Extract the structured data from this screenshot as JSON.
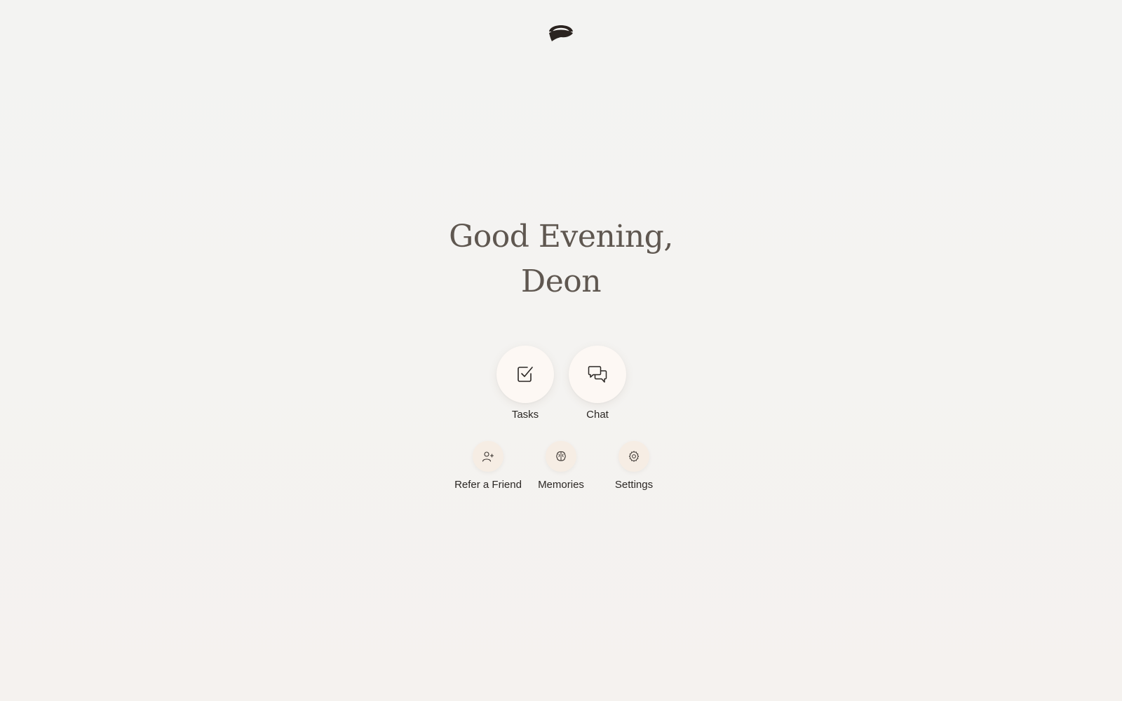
{
  "greeting": {
    "line1": "Good Evening,",
    "line2": "Deon"
  },
  "primary_actions": [
    {
      "label": "Tasks",
      "icon": "checkbox-icon"
    },
    {
      "label": "Chat",
      "icon": "chat-bubbles-icon"
    }
  ],
  "secondary_actions": [
    {
      "label": "Refer a Friend",
      "icon": "user-plus-icon"
    },
    {
      "label": "Memories",
      "icon": "brain-icon"
    },
    {
      "label": "Settings",
      "icon": "gear-icon"
    }
  ],
  "colors": {
    "background": "#f4f3f1",
    "greeting_text": "#5f5750",
    "primary_circle": "#fdf8f4",
    "secondary_circle": "#f6ede4",
    "logo": "#2a2320"
  }
}
